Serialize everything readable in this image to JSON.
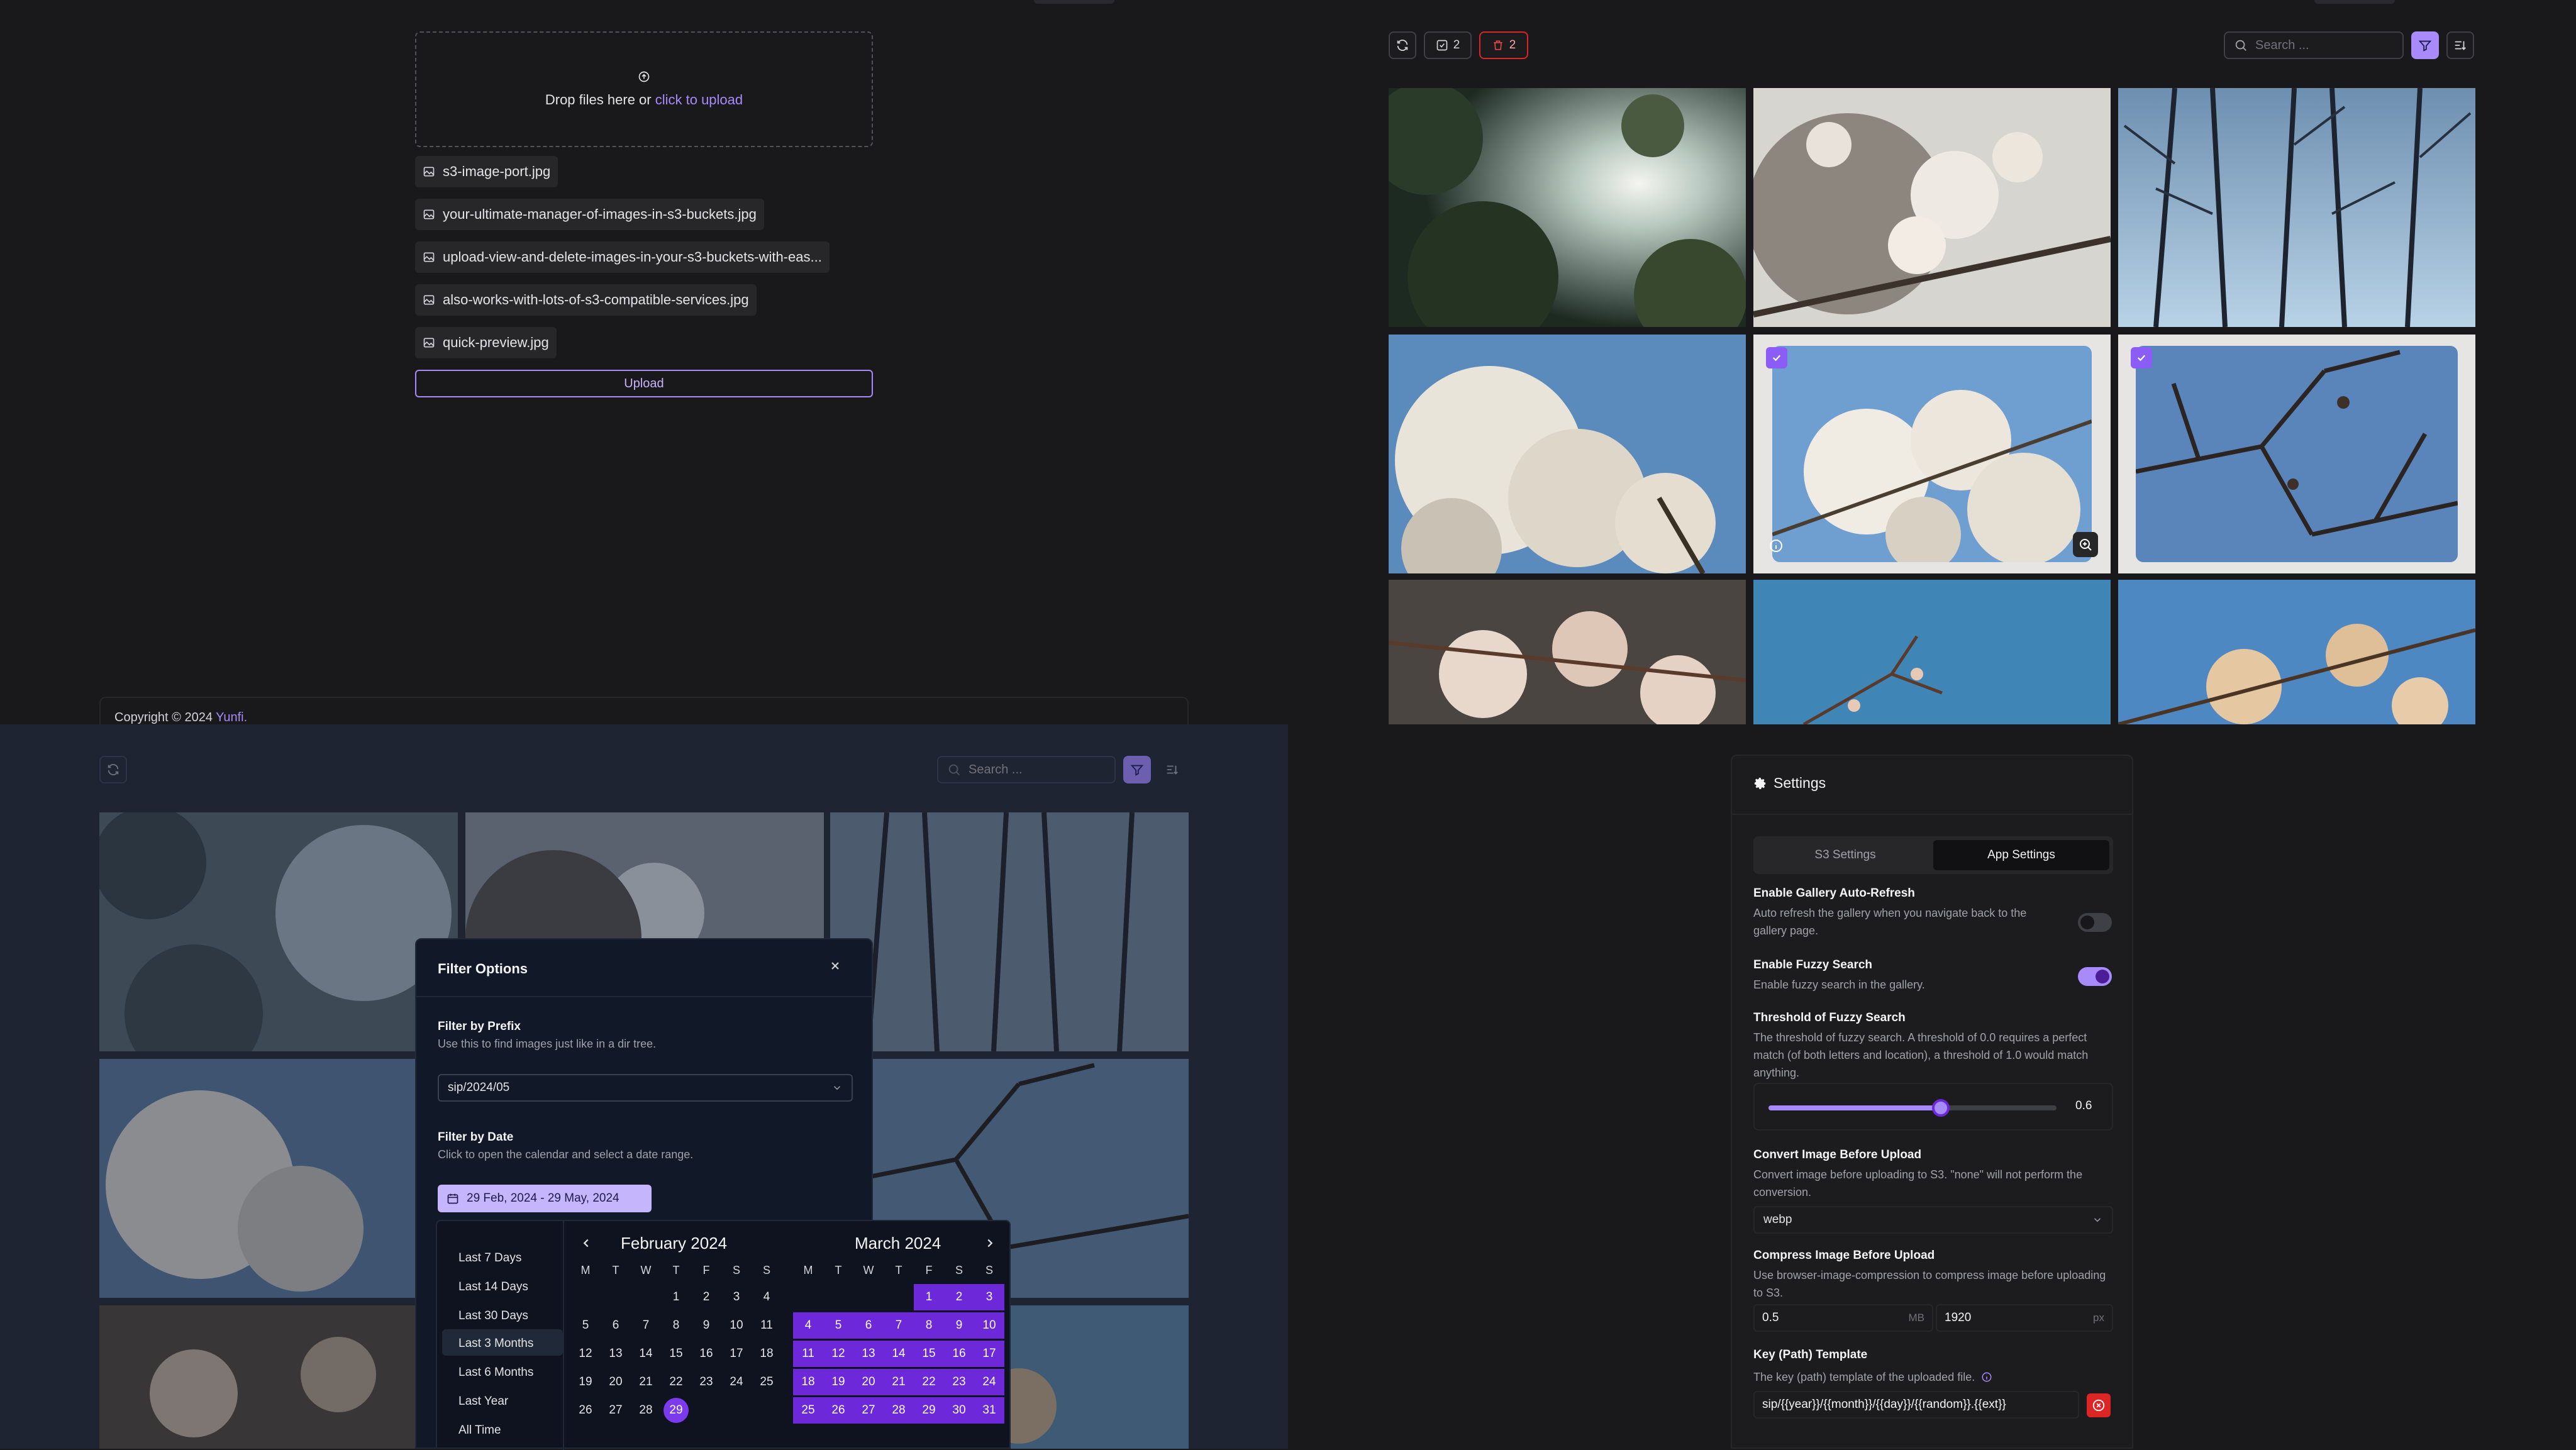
{
  "upload": {
    "drop_text": "Drop files here or ",
    "drop_link": "click to upload",
    "files": [
      "s3-image-port.jpg",
      "your-ultimate-manager-of-images-in-s3-buckets.jpg",
      "upload-view-and-delete-images-in-your-s3-buckets-with-eas...",
      "also-works-with-lots-of-s3-compatible-services.jpg",
      "quick-preview.jpg"
    ],
    "upload_label": "Upload"
  },
  "footer": {
    "copyright": "Copyright © 2024 ",
    "brand": "Yunfi."
  },
  "gallery": {
    "select_count": "2",
    "delete_count": "2",
    "search_placeholder": "Search ...",
    "accent": "#8b5cf6",
    "danger": "#ef4444"
  },
  "filter": {
    "title": "Filter Options",
    "prefix_label": "Filter by Prefix",
    "prefix_desc": "Use this to find images just like in a dir tree.",
    "prefix_value": "sip/2024/05",
    "date_label": "Filter by Date",
    "date_desc": "Click to open the calendar and select a date range.",
    "date_range": "29 Feb, 2024 - 29 May, 2024",
    "presets": [
      "Last 7 Days",
      "Last 14 Days",
      "Last 30 Days",
      "Last 3 Months",
      "Last 6 Months",
      "Last Year",
      "All Time"
    ],
    "weekdays": [
      "M",
      "T",
      "W",
      "T",
      "F",
      "S",
      "S"
    ],
    "months": [
      "February 2024",
      "March 2024"
    ]
  },
  "settings": {
    "title": "Settings",
    "tabs": [
      "S3 Settings",
      "App Settings"
    ],
    "auto_refresh": {
      "label": "Enable Gallery Auto-Refresh",
      "desc": "Auto refresh the gallery when you navigate back to the gallery page."
    },
    "fuzzy": {
      "label": "Enable Fuzzy Search",
      "desc": "Enable fuzzy search in the gallery."
    },
    "threshold": {
      "label": "Threshold of Fuzzy Search",
      "desc": "The threshold of fuzzy search. A threshold of 0.0 requires a perfect match (of both letters and location), a threshold of 1.0 would match anything.",
      "value": "0.6"
    },
    "convert": {
      "label": "Convert Image Before Upload",
      "desc": "Convert image before uploading to S3. \"none\" will not perform the conversion.",
      "value": "webp"
    },
    "compress": {
      "label": "Compress Image Before Upload",
      "desc": "Use browser-image-compression to compress image before uploading to S3.",
      "size": "0.5",
      "size_unit": "MB",
      "dim": "1920",
      "dim_unit": "px"
    },
    "key_template": {
      "label": "Key (Path) Template",
      "desc": "The key (path) template of the uploaded file.",
      "value": "sip/{{year}}/{{month}}/{{day}}/{{random}}.{{ext}}"
    }
  }
}
